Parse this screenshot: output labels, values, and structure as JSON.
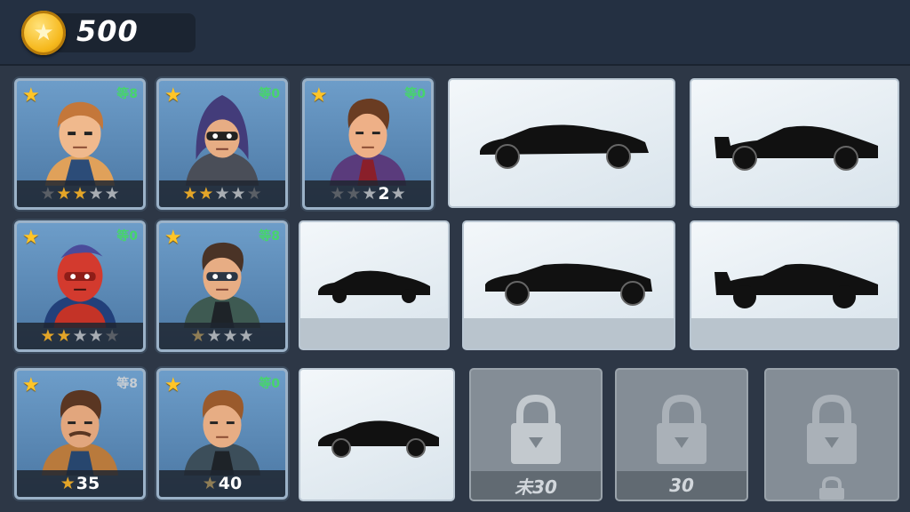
{
  "header": {
    "coins": "500",
    "coin_icon": "star-coin-icon"
  },
  "characters": [
    {
      "level": "等8",
      "rating_text": "",
      "stars": [
        "dark",
        "on",
        "on",
        "off",
        "off"
      ]
    },
    {
      "level": "等0",
      "rating_text": "",
      "stars": [
        "on",
        "on",
        "off",
        "off",
        "off"
      ]
    },
    {
      "level": "等0",
      "rating_text": "2",
      "stars": [
        "dark",
        "dark",
        "off"
      ],
      "trail_star": "off"
    },
    {
      "level": "等0",
      "rating_text": "",
      "stars": [
        "on",
        "on",
        "off",
        "off",
        "dark"
      ]
    },
    {
      "level": "等8",
      "rating_text": "",
      "stars": [
        "dim",
        "off",
        "off",
        "off"
      ]
    },
    {
      "level": "等8",
      "price": "35"
    },
    {
      "level": "等0",
      "price": "40"
    }
  ],
  "cars": [
    {
      "status": "owned"
    },
    {
      "status": "owned"
    },
    {
      "status": "owned"
    },
    {
      "status": "owned"
    },
    {
      "status": "owned"
    },
    {
      "status": "owned"
    }
  ],
  "locked": [
    {
      "price": "未30"
    },
    {
      "price": "30"
    },
    {
      "price": ""
    }
  ],
  "colors": {
    "background": "#2d3746",
    "coin": "#f6b81c",
    "level": "#46d56c"
  }
}
